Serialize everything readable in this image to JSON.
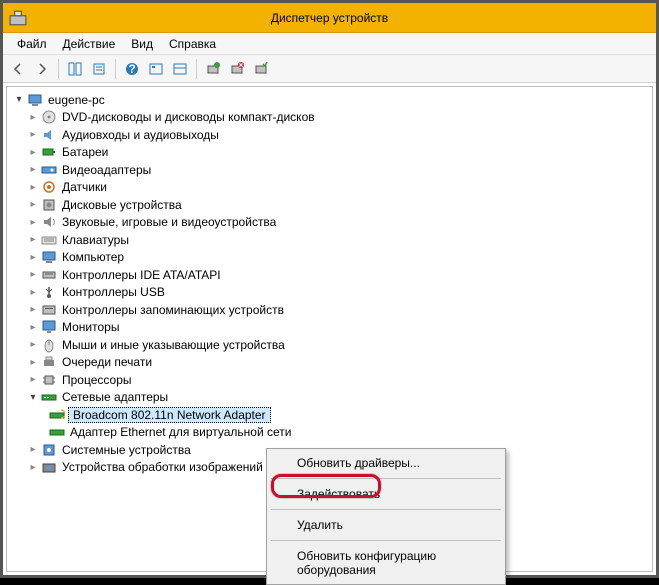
{
  "window": {
    "title": "Диспетчер устройств"
  },
  "menu": {
    "file": "Файл",
    "action": "Действие",
    "view": "Вид",
    "help": "Справка"
  },
  "tree": {
    "root": "eugene-pc",
    "nodes": [
      {
        "icon": "dvd",
        "label": "DVD-дисководы и дисководы компакт-дисков"
      },
      {
        "icon": "audio",
        "label": "Аудиовходы и аудиовыходы"
      },
      {
        "icon": "battery",
        "label": "Батареи"
      },
      {
        "icon": "video",
        "label": "Видеоадаптеры"
      },
      {
        "icon": "sensor",
        "label": "Датчики"
      },
      {
        "icon": "disk",
        "label": "Дисковые устройства"
      },
      {
        "icon": "sound",
        "label": "Звуковые, игровые и видеоустройства"
      },
      {
        "icon": "keyboard",
        "label": "Клавиатуры"
      },
      {
        "icon": "computer",
        "label": "Компьютер"
      },
      {
        "icon": "ide",
        "label": "Контроллеры IDE ATA/ATAPI"
      },
      {
        "icon": "usb",
        "label": "Контроллеры USB"
      },
      {
        "icon": "storage",
        "label": "Контроллеры запоминающих устройств"
      },
      {
        "icon": "monitor",
        "label": "Мониторы"
      },
      {
        "icon": "mouse",
        "label": "Мыши и иные указывающие устройства"
      },
      {
        "icon": "print",
        "label": "Очереди печати"
      },
      {
        "icon": "cpu",
        "label": "Процессоры"
      }
    ],
    "network": {
      "label": "Сетевые адаптеры",
      "children": [
        {
          "label": "Broadcom 802.11n Network Adapter",
          "selected": true
        },
        {
          "label": "Адаптер Ethernet для виртуальной сети"
        }
      ]
    },
    "after": [
      {
        "icon": "sys",
        "label": "Системные устройства"
      },
      {
        "icon": "imaging",
        "label": "Устройства обработки изображений"
      }
    ]
  },
  "context_menu": {
    "update_drivers": "Обновить драйверы...",
    "enable": "Задействовать",
    "delete": "Удалить",
    "refresh_config": "Обновить конфигурацию оборудования"
  }
}
